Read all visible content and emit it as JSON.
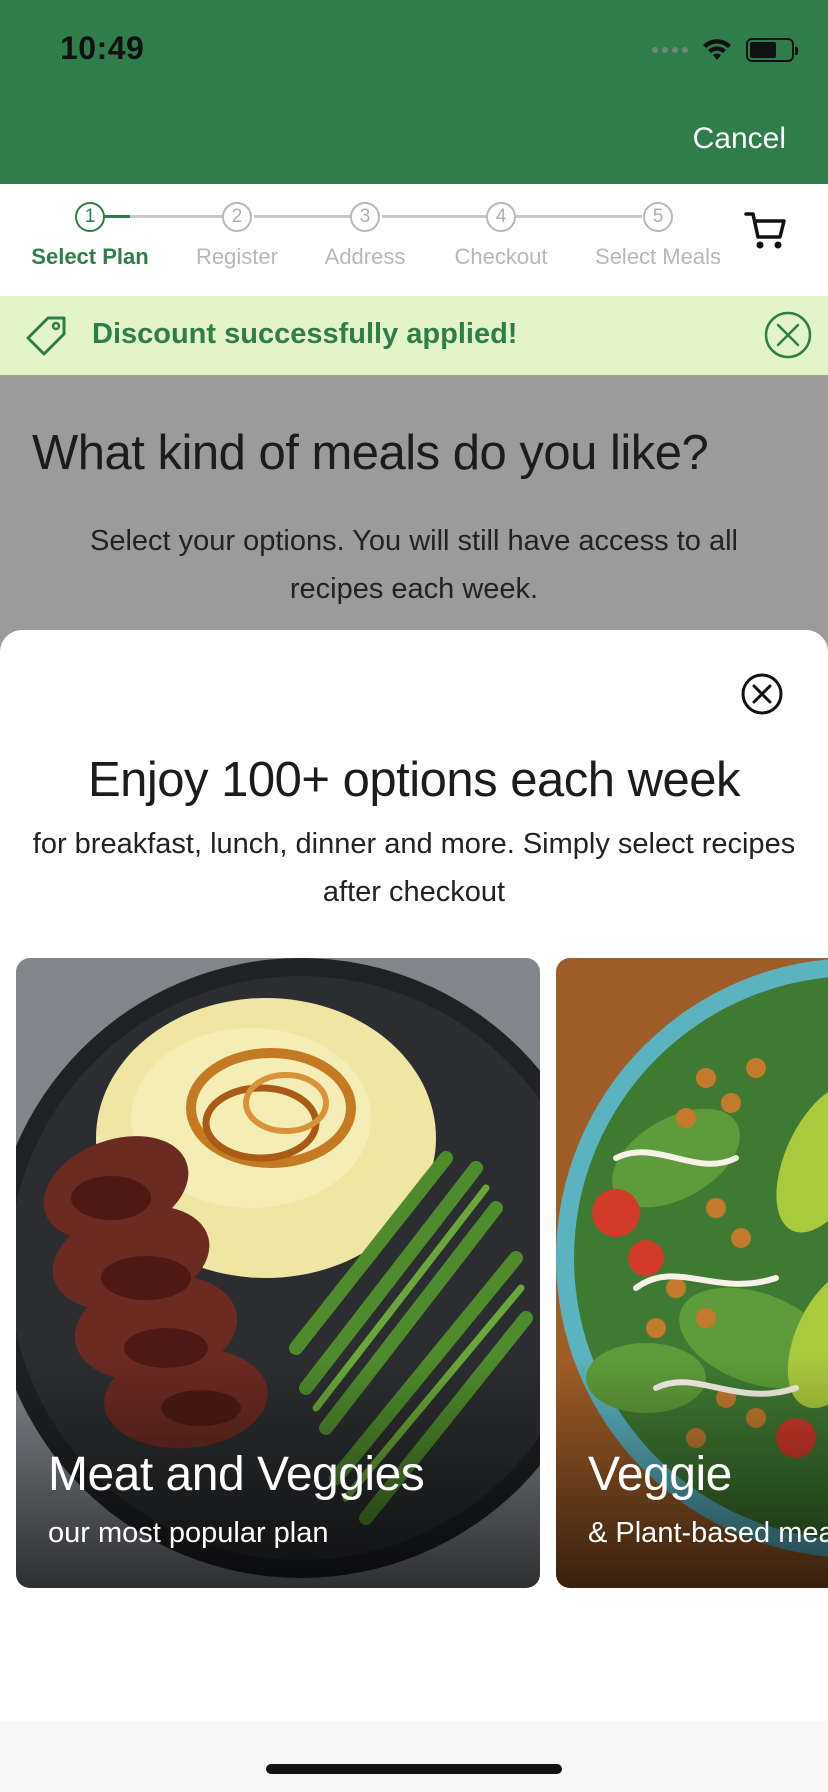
{
  "status_bar": {
    "time": "10:49",
    "icons": [
      "signal-dots-icon",
      "wifi-icon",
      "battery-icon"
    ]
  },
  "header": {
    "cancel_label": "Cancel"
  },
  "stepper": {
    "steps": [
      {
        "num": "1",
        "label": "Select Plan",
        "active": true
      },
      {
        "num": "2",
        "label": "Register",
        "active": false
      },
      {
        "num": "3",
        "label": "Address",
        "active": false
      },
      {
        "num": "4",
        "label": "Checkout",
        "active": false
      },
      {
        "num": "5",
        "label": "Select Meals",
        "active": false
      }
    ],
    "cart_icon": "cart-icon"
  },
  "discount_banner": {
    "text": "Discount successfully applied!",
    "icon": "tag-icon",
    "close_icon": "close-circle-icon"
  },
  "background_page": {
    "title": "What kind of meals do you like?",
    "subtitle": "Select your options. You will still have access to all recipes each week."
  },
  "sheet": {
    "close_icon": "close-circle-icon",
    "title": "Enjoy 100+ options each week",
    "subtitle": "for breakfast, lunch, dinner and more. Simply select recipes after checkout",
    "cards": [
      {
        "title": "Meat and Veggies",
        "tagline": "our most popular plan"
      },
      {
        "title": "Veggie",
        "tagline": "& Plant-based meals"
      }
    ]
  },
  "colors": {
    "brand_green": "#2e7d4a",
    "banner_bg": "#e3f5c8",
    "overlay_gray": "#9b9b9b"
  }
}
